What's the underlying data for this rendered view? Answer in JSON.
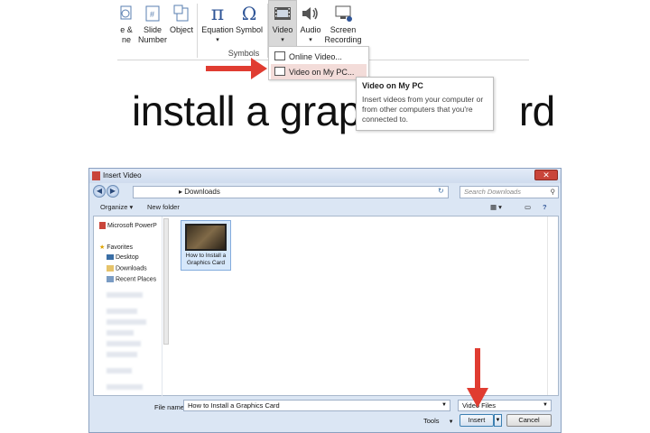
{
  "ribbon": {
    "buttons": [
      {
        "label": "e &\nne"
      },
      {
        "label": "Slide\nNumber"
      },
      {
        "label": "Object"
      },
      {
        "label": "Equation"
      },
      {
        "label": "Symbol"
      },
      {
        "label": "Video"
      },
      {
        "label": "Audio"
      },
      {
        "label": "Screen\nRecording"
      }
    ],
    "group_label": "Symbols",
    "equation_glyph": "π",
    "symbol_glyph": "Ω"
  },
  "video_menu": {
    "items": [
      {
        "label": "Online Video..."
      },
      {
        "label": "Video on My PC..."
      }
    ]
  },
  "tooltip": {
    "title": "Video on My PC",
    "body": "Insert videos from your computer or from other computers that you're connected to."
  },
  "slide_text": "install a grap",
  "slide_text_tail": "rd",
  "dialog": {
    "title": "Insert Video",
    "close": "✕",
    "address": "▸ Downloads",
    "search_placeholder": "Search Downloads",
    "toolbar": {
      "organize": "Organize ▾",
      "new_folder": "New folder"
    },
    "nav": {
      "powerpoint": "Microsoft PowerP",
      "favorites": "Favorites",
      "desktop": "Desktop",
      "downloads": "Downloads",
      "recent": "Recent Places"
    },
    "file": {
      "name": "How to Install a Graphics Card"
    },
    "file_name_label": "File name:",
    "file_name_value": "How to Install a Graphics Card",
    "file_type_value": "Video Files",
    "tools_label": "Tools",
    "insert_label": "Insert",
    "cancel_label": "Cancel"
  },
  "colors": {
    "arrow": "#e03c31",
    "accent": "#3c7fb1"
  }
}
